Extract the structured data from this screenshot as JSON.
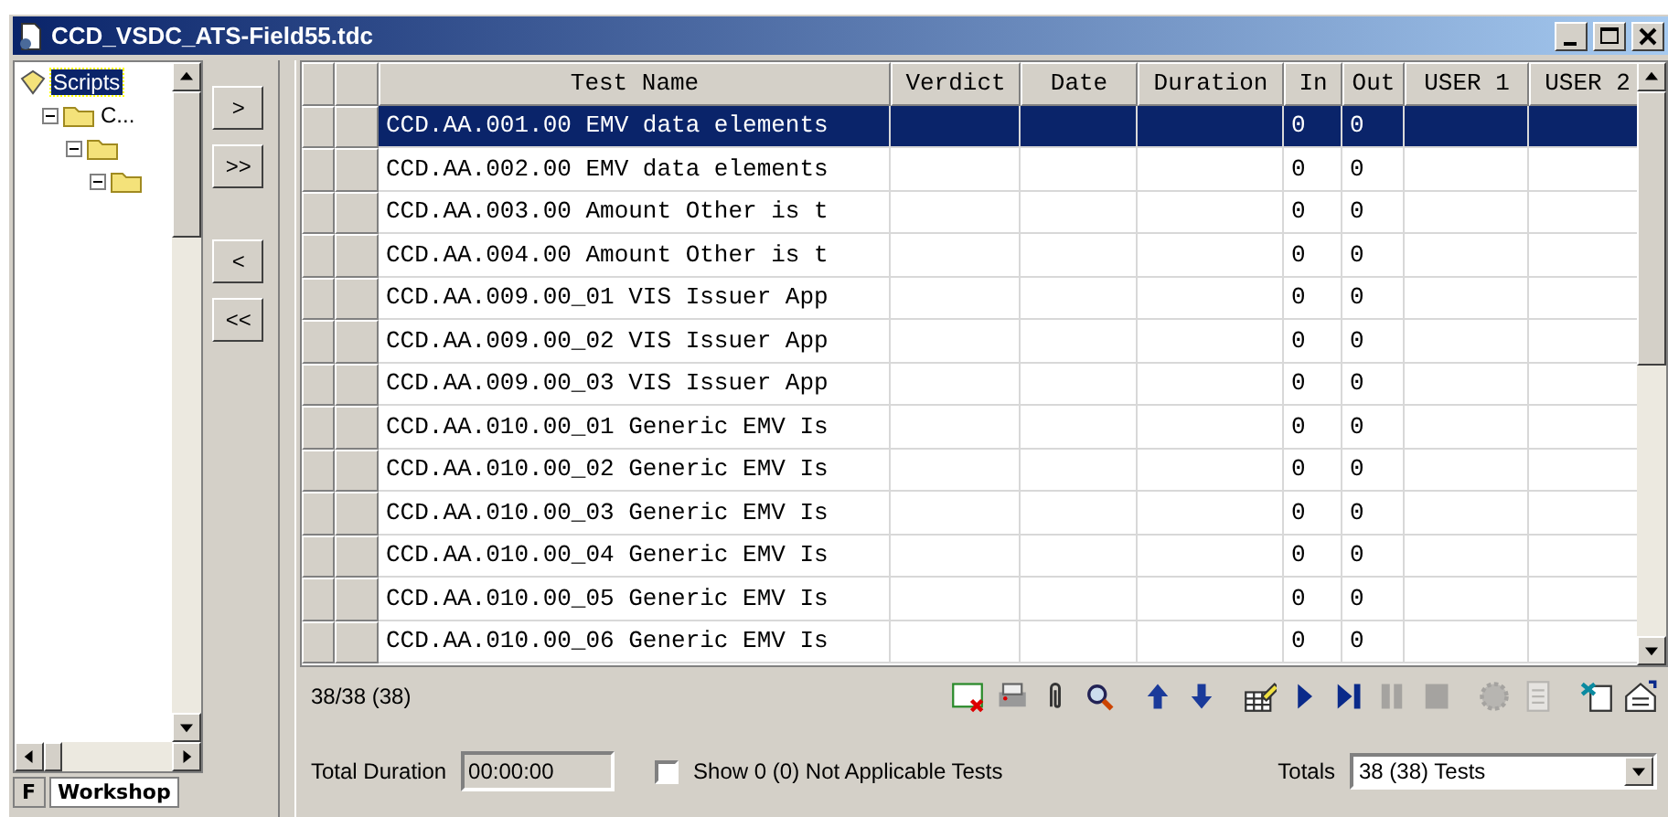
{
  "window": {
    "title": "CCD_VSDC_ATS-Field55.tdc"
  },
  "tree": [
    {
      "label": "Scripts",
      "selected": true,
      "kind": "root",
      "children": [
        {
          "label": "C...",
          "selected": false,
          "expanded": true,
          "kind": "folder",
          "children": [
            {
              "expanded": true,
              "kind": "folder",
              "children": [
                {
                  "expanded": true,
                  "kind": "folder"
                }
              ]
            }
          ]
        }
      ]
    }
  ],
  "move_buttons": [
    ">",
    ">>",
    "<",
    "<<"
  ],
  "left_tabs": [
    {
      "label": "F",
      "selected": false
    },
    {
      "label": "Workshop",
      "selected": true
    }
  ],
  "table": {
    "columns": [
      "Test Name",
      "Verdict",
      "Date",
      "Duration",
      "In",
      "Out",
      "USER 1",
      "USER 2"
    ],
    "rows": [
      {
        "name": "CCD.AA.001.00 EMV data elements",
        "in": "0",
        "out": "0",
        "selected": true
      },
      {
        "name": "CCD.AA.002.00 EMV data elements",
        "in": "0",
        "out": "0",
        "selected": false
      },
      {
        "name": "CCD.AA.003.00 Amount Other is t",
        "in": "0",
        "out": "0",
        "selected": false
      },
      {
        "name": "CCD.AA.004.00 Amount Other is t",
        "in": "0",
        "out": "0",
        "selected": false
      },
      {
        "name": "CCD.AA.009.00_01 VIS Issuer App",
        "in": "0",
        "out": "0",
        "selected": false
      },
      {
        "name": "CCD.AA.009.00_02 VIS Issuer App",
        "in": "0",
        "out": "0",
        "selected": false
      },
      {
        "name": "CCD.AA.009.00_03 VIS Issuer App",
        "in": "0",
        "out": "0",
        "selected": false
      },
      {
        "name": "CCD.AA.010.00_01 Generic EMV Is",
        "in": "0",
        "out": "0",
        "selected": false
      },
      {
        "name": "CCD.AA.010.00_02 Generic EMV Is",
        "in": "0",
        "out": "0",
        "selected": false
      },
      {
        "name": "CCD.AA.010.00_03 Generic EMV Is",
        "in": "0",
        "out": "0",
        "selected": false
      },
      {
        "name": "CCD.AA.010.00_04 Generic EMV Is",
        "in": "0",
        "out": "0",
        "selected": false
      },
      {
        "name": "CCD.AA.010.00_05 Generic EMV Is",
        "in": "0",
        "out": "0",
        "selected": false
      },
      {
        "name": "CCD.AA.010.00_06 Generic EMV Is",
        "in": "0",
        "out": "0",
        "selected": false
      }
    ]
  },
  "status": "38/38 (38)",
  "toolbar": [
    {
      "kind": "report",
      "disabled": false
    },
    {
      "kind": "print",
      "disabled": false
    },
    {
      "kind": "attach",
      "disabled": false
    },
    {
      "kind": "find",
      "disabled": false
    },
    {
      "kind": "up",
      "disabled": false
    },
    {
      "kind": "down",
      "disabled": false
    },
    {
      "kind": "edit",
      "disabled": false
    },
    {
      "kind": "play",
      "disabled": false
    },
    {
      "kind": "step",
      "disabled": false
    },
    {
      "kind": "pause",
      "disabled": true
    },
    {
      "kind": "stop",
      "disabled": true
    },
    {
      "kind": "gear",
      "disabled": true
    },
    {
      "kind": "notes",
      "disabled": true
    },
    {
      "kind": "export",
      "disabled": false
    },
    {
      "kind": "properties",
      "disabled": false
    }
  ],
  "total_duration": {
    "label": "Total Duration",
    "value": "00:00:00"
  },
  "show_na": {
    "label": "Show 0 (0) Not Applicable Tests",
    "checked": false
  },
  "totals": {
    "label": "Totals",
    "value": "38 (38) Tests"
  }
}
